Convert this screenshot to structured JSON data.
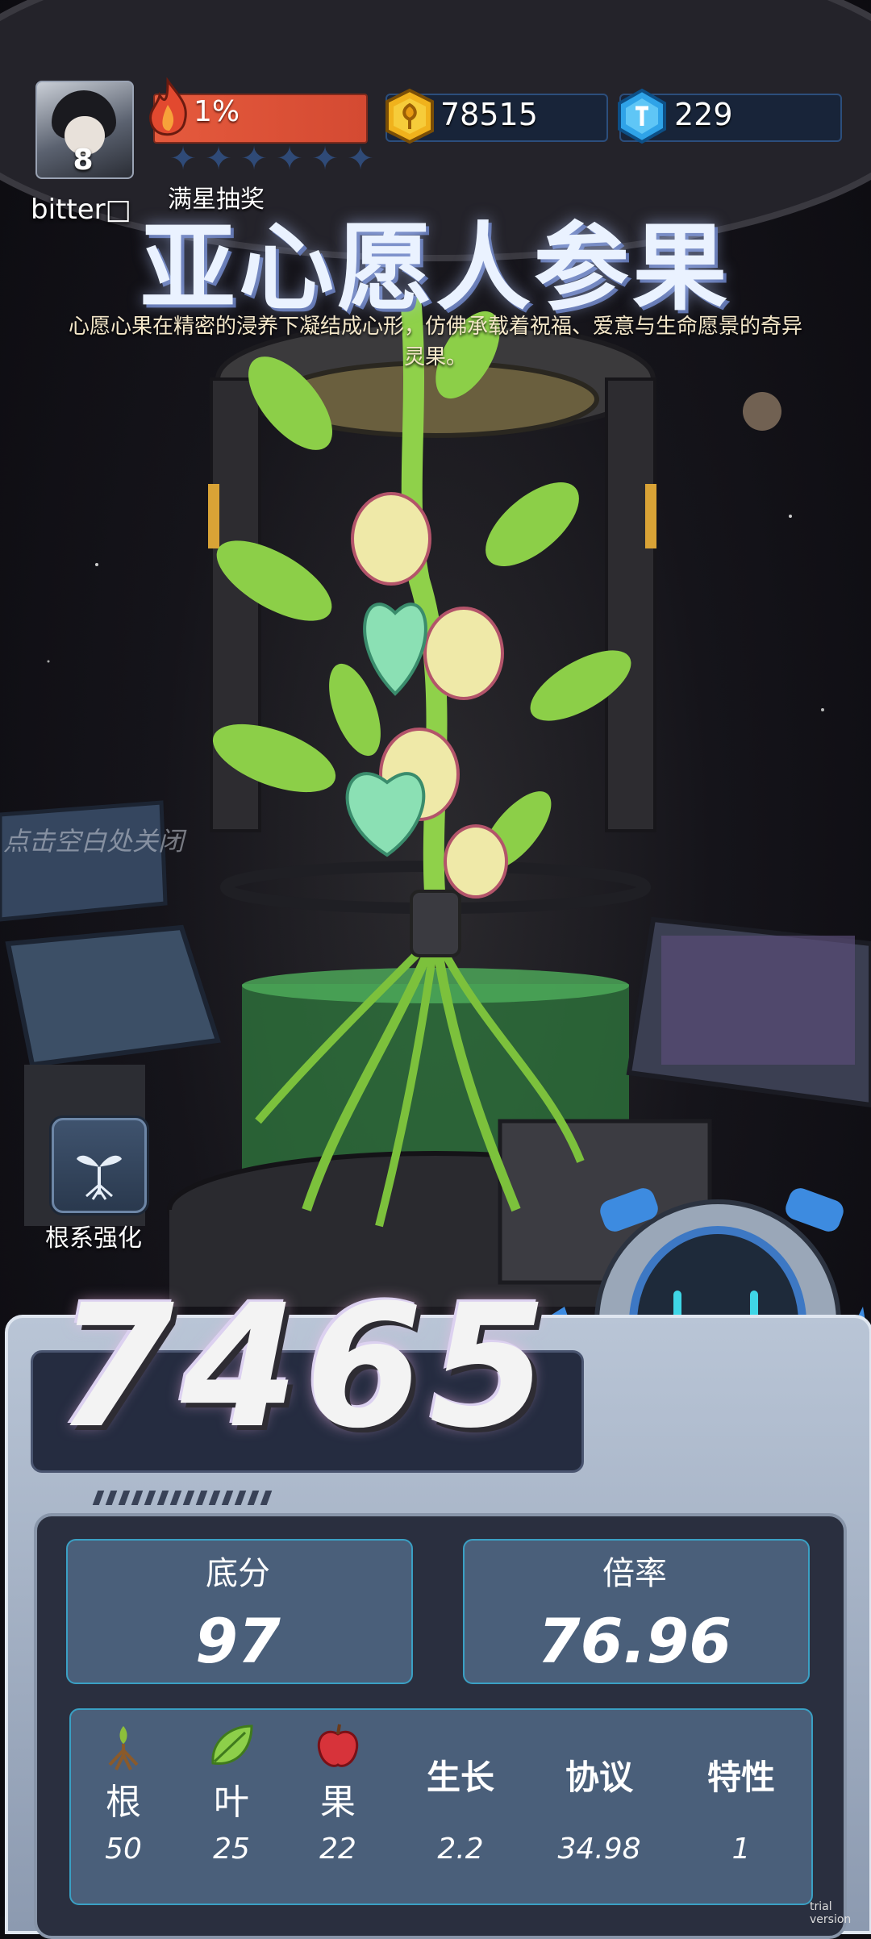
{
  "player": {
    "level": "8",
    "name": "bitter□"
  },
  "energy": {
    "percent_label": "1%",
    "stars_filled": 0,
    "stars_total": 6
  },
  "currency": {
    "coins": "78515",
    "gems": "229"
  },
  "lottery_label": "满星抽奖",
  "item": {
    "title": "亚心愿人参果",
    "description": "心愿心果在精密的浸养下凝结成心形，仿佛承载着祝福、爱意与生命愿景的奇异灵果。"
  },
  "close_hint": "点击空白处关闭",
  "root_enhance_label": "根系强化",
  "score": {
    "total": "7465",
    "base_label": "底分",
    "base_value": "97",
    "multiplier_label": "倍率",
    "multiplier_value": "76.96"
  },
  "attributes": [
    {
      "name": "根",
      "value": "50",
      "icon": "root-icon"
    },
    {
      "name": "叶",
      "value": "25",
      "icon": "leaf-icon"
    },
    {
      "name": "果",
      "value": "22",
      "icon": "apple-icon"
    },
    {
      "name": "生长",
      "value": "2.2"
    },
    {
      "name": "协议",
      "value": "34.98"
    },
    {
      "name": "特性",
      "value": "1"
    }
  ],
  "watermark": "trial version",
  "colors": {
    "fire": "#e55a3d",
    "accent": "#3aa0c4",
    "panel": "#4a5f7a"
  }
}
